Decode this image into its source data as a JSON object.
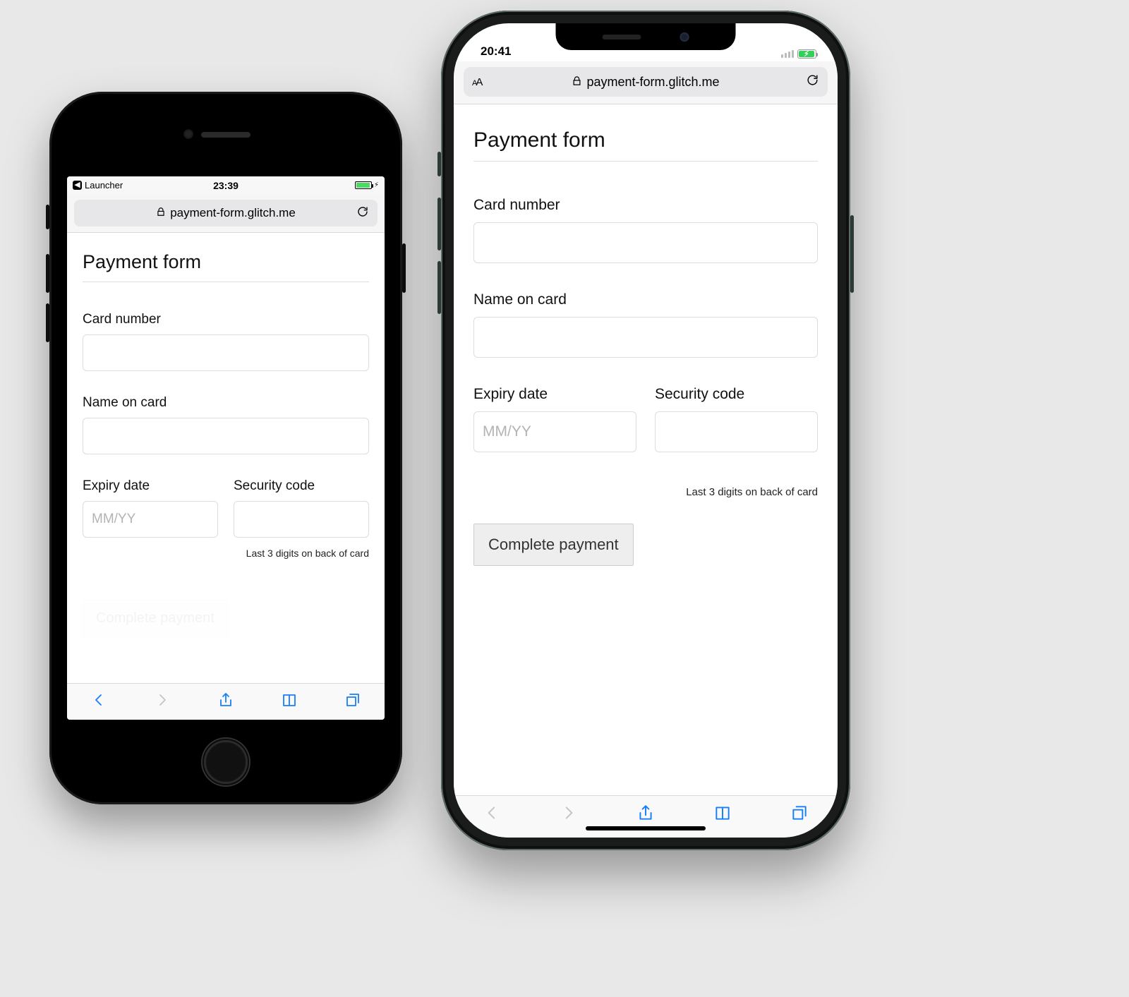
{
  "phone7": {
    "status": {
      "back_app": "Launcher",
      "time": "23:39"
    },
    "url": "payment-form.glitch.me"
  },
  "phone11": {
    "status": {
      "time": "20:41"
    },
    "url": "payment-form.glitch.me"
  },
  "form": {
    "title": "Payment form",
    "card_number_label": "Card number",
    "name_label": "Name on card",
    "expiry_label": "Expiry date",
    "expiry_placeholder": "MM/YY",
    "cvc_label": "Security code",
    "cvc_hint": "Last 3 digits on back of card",
    "submit_label": "Complete payment"
  }
}
